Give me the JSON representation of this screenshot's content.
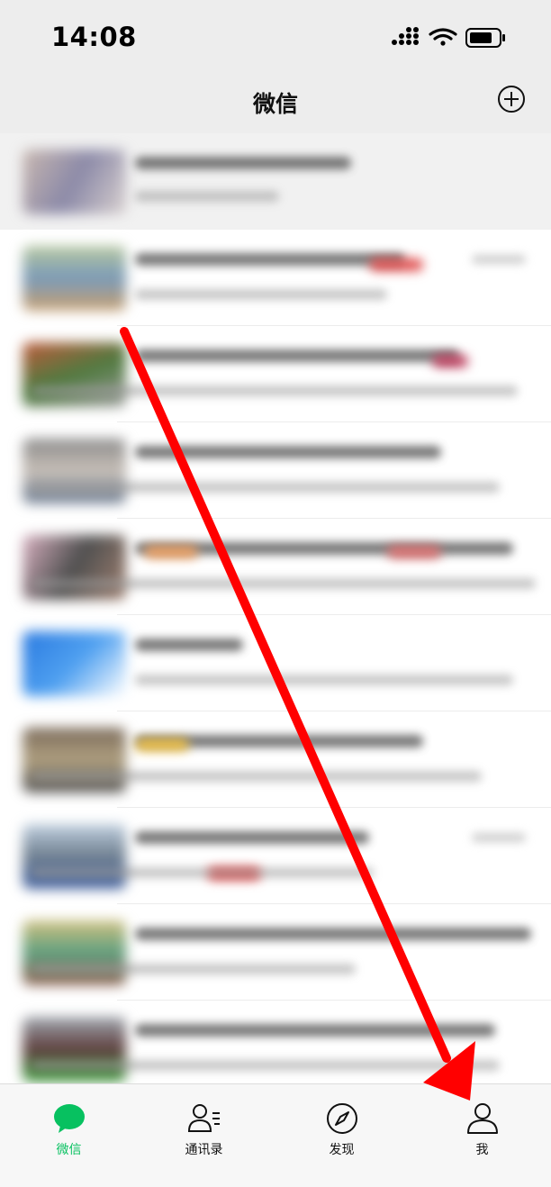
{
  "status_bar": {
    "time": "14:08"
  },
  "nav": {
    "title": "微信",
    "plus_icon": "add-circle-icon"
  },
  "chat_list": {
    "rows_count_visible": 10
  },
  "tab_bar": {
    "tabs": [
      {
        "label": "微信",
        "icon": "chat-bubble-icon",
        "active": true
      },
      {
        "label": "通讯录",
        "icon": "contacts-icon",
        "active": false
      },
      {
        "label": "发现",
        "icon": "compass-icon",
        "active": false
      },
      {
        "label": "我",
        "icon": "profile-icon",
        "active": false
      }
    ]
  },
  "colors": {
    "accent_green": "#07c160",
    "annotation_arrow": "#ff0000",
    "header_bg": "#ededed"
  }
}
